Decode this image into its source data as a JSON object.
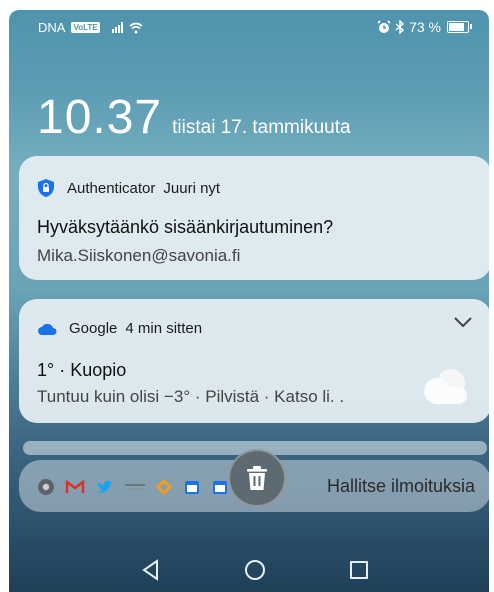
{
  "status_bar": {
    "carrier": "DNA",
    "volte": "VoLTE",
    "battery": "73 %",
    "battery_level": 0.73,
    "icons": [
      "signal-icon",
      "wifi-icon",
      "alarm-icon",
      "bluetooth-icon",
      "battery-icon"
    ]
  },
  "lock_screen": {
    "time": "10.37",
    "date": "tiistai 17. tammikuuta"
  },
  "notifications": [
    {
      "app": "Authenticator",
      "when": "Juuri nyt",
      "title": "Hyväksytäänkö sisäänkirjautuminen?",
      "body": "Mika.Siiskonen@savonia.fi",
      "icon": "shield-lock-icon"
    },
    {
      "app": "Google",
      "when": "4 min sitten",
      "title": "1° · Kuopio",
      "body": "Tuntuu kuin olisi −3° · Pilvistä · Katso li. .",
      "icon": "cloud-icon"
    }
  ],
  "manage": {
    "label": "Hallitse ilmoituksia",
    "app_icons": [
      "chrome-icon",
      "gmail-icon",
      "twitter-icon",
      "news-icon",
      "app-icon",
      "calendar-icon",
      "calendar-icon"
    ]
  },
  "colors": {
    "accent_blue": "#1a73e8",
    "gmail_red": "#d93025",
    "twitter_blue": "#1da1f2"
  }
}
